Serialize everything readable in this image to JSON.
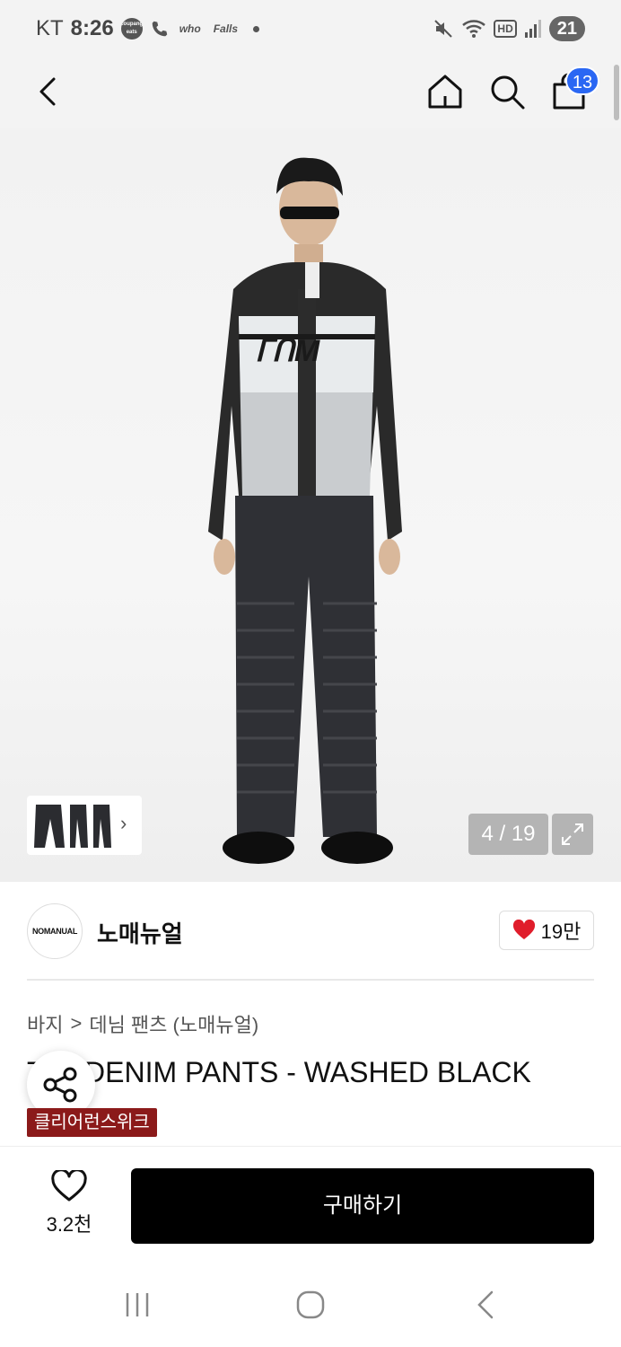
{
  "status_bar": {
    "carrier": "KT",
    "time": "8:26",
    "app_icons": [
      "coupang eats",
      "who",
      "Falls"
    ],
    "hd": "HD",
    "battery": "21"
  },
  "header": {
    "cart_count": "13"
  },
  "gallery": {
    "counter": "4 / 19"
  },
  "brand": {
    "logo_text": "NOMANUAL",
    "name": "노매뉴얼",
    "likes": "19만"
  },
  "breadcrumb": {
    "category": "바지",
    "separator": ">",
    "subcategory": "데님 팬츠 (노매뉴얼)"
  },
  "product": {
    "title": "T.S. DENIM PANTS - WASHED BLACK",
    "tag": "클리어런스위크"
  },
  "actions": {
    "wishlist_count": "3.2천",
    "buy_label": "구매하기"
  },
  "colors": {
    "badge": "#2a67f3",
    "tag": "#8b1a1a",
    "heart": "#e01d2b"
  }
}
